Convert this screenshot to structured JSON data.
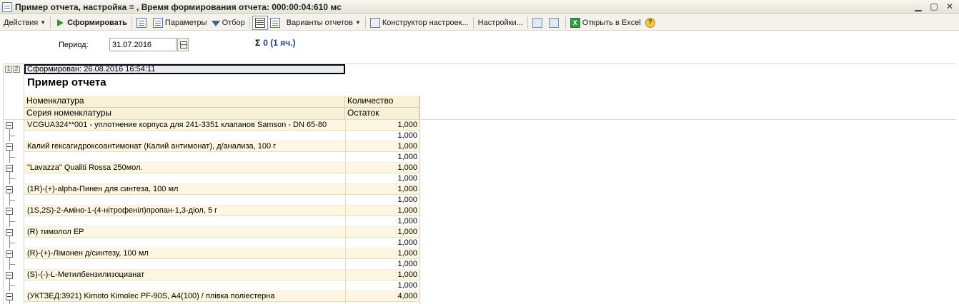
{
  "window": {
    "title": "Пример отчета, настройка = ,  Время формирования отчета: 000:00:04:610 мс"
  },
  "toolbar": {
    "actions_label": "Действия",
    "generate_label": "Сформировать",
    "parameters_label": "Параметры",
    "filter_label": "Отбор",
    "variants_label": "Варианты отчетов",
    "constructor_label": "Конструктор настроек...",
    "settings_label": "Настройки...",
    "excel_label": "Открыть в Excel"
  },
  "form": {
    "period_label": "Период:",
    "period_value": "31.07.2016",
    "sum_text": "0 (1 яч.)"
  },
  "report": {
    "generated": "Сформирован: 26.08.2016 16:54:11",
    "title": "Пример отчета",
    "col1_header1": "Номенклатура",
    "col1_header2": "Серия номенклатуры",
    "col2_header1": "Количество",
    "col2_header2": "Остаток",
    "rows": [
      {
        "name": "VCGUA324**001 - уплотнение корпуса для 241-3351 клапанов Samson - DN 65-80",
        "qty": "1,000",
        "detail_qty": "1,000"
      },
      {
        "name": "Калий гексагидроксоантимонат (Калий антимонат), д/анализа, 100 г",
        "qty": "1,000",
        "detail_qty": "1,000"
      },
      {
        "name": "\"Lavazza\" Qualiti Rossa 250мол.",
        "qty": "1,000",
        "detail_qty": "1,000"
      },
      {
        "name": "(1R)-(+)-alpha-Пинен для синтеза, 100 мл",
        "qty": "1,000",
        "detail_qty": "1,000"
      },
      {
        "name": "(1S,2S)-2-Аміно-1-(4-нітрофеніл)пропан-1,3-діол, 5 г",
        "qty": "1,000",
        "detail_qty": "1,000"
      },
      {
        "name": "(R) тимолол EP",
        "qty": "1,000",
        "detail_qty": "1,000"
      },
      {
        "name": "(R)-(+)-Лімонен д/синтезу, 100 мл",
        "qty": "1,000",
        "detail_qty": "1,000"
      },
      {
        "name": "(S)-(-)-L-Метилбензилизоцианат",
        "qty": "1,000",
        "detail_qty": "1,000"
      },
      {
        "name": "(УКТЗЕД:3921) Kimoto Kimolec PF-90S, A4(100) / плівка поліестерна",
        "qty": "4,000",
        "detail_qty": ""
      }
    ]
  }
}
